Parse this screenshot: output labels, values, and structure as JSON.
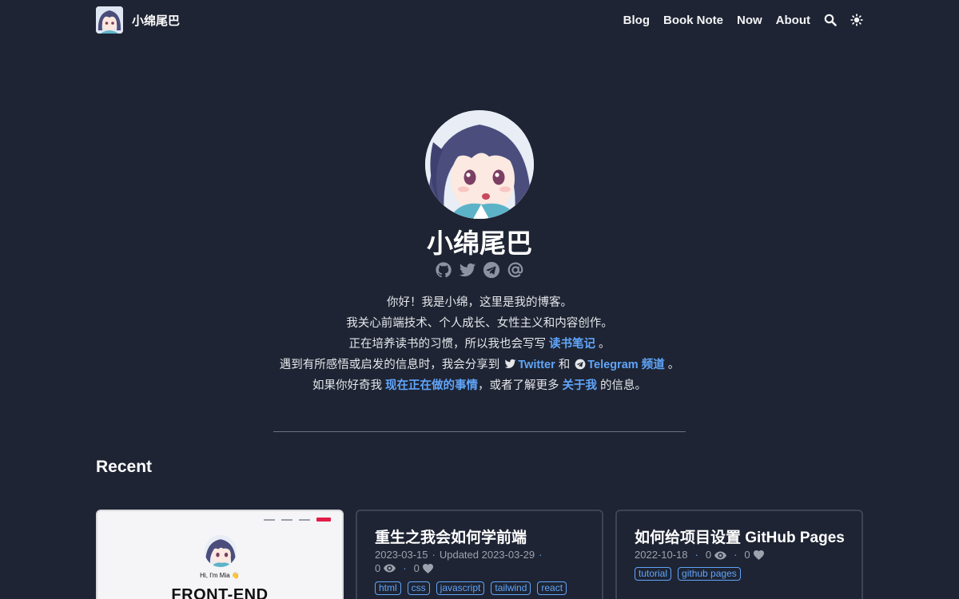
{
  "site": {
    "name": "小绵尾巴"
  },
  "nav": {
    "items": [
      "Blog",
      "Book Note",
      "Now",
      "About"
    ]
  },
  "hero": {
    "name": "小绵尾巴",
    "line1": "你好！我是小绵，这里是我的博客。",
    "line2": "我关心前端技术、个人成长、女性主义和内容创作。",
    "line3_pre": "正在培养读书的习惯，所以我也会写写 ",
    "line3_link": "读书笔记",
    "line3_post": " 。",
    "line4_pre": "遇到有所感悟或启发的信息时，我会分享到 ",
    "line4_twitter": "Twitter",
    "line4_mid": " 和 ",
    "line4_telegram": "Telegram 频道",
    "line4_post": " 。",
    "line5_pre": "如果你好奇我 ",
    "line5_link1": "现在正在做的事情",
    "line5_mid": "，或者了解更多 ",
    "line5_link2": "关于我",
    "line5_post": " 的信息。"
  },
  "recent": {
    "title": "Recent",
    "screenshot": {
      "hi": "Hi, I'm Mia 👋",
      "big": "FRONT-END"
    },
    "posts": [
      {
        "title": "重生之我会如何学前端",
        "date": "2023-03-15",
        "updated": "Updated 2023-03-29",
        "views": "0",
        "likes": "0",
        "tags": [
          "html",
          "css",
          "javascript",
          "tailwind",
          "react"
        ]
      },
      {
        "title": "如何给项目设置 GitHub Pages",
        "date": "2022-10-18",
        "views": "0",
        "likes": "0",
        "tags": [
          "tutorial",
          "github pages"
        ]
      }
    ]
  },
  "colors": {
    "background": "#1e2433",
    "link": "#60a5fa",
    "text": "#e5e7eb"
  }
}
